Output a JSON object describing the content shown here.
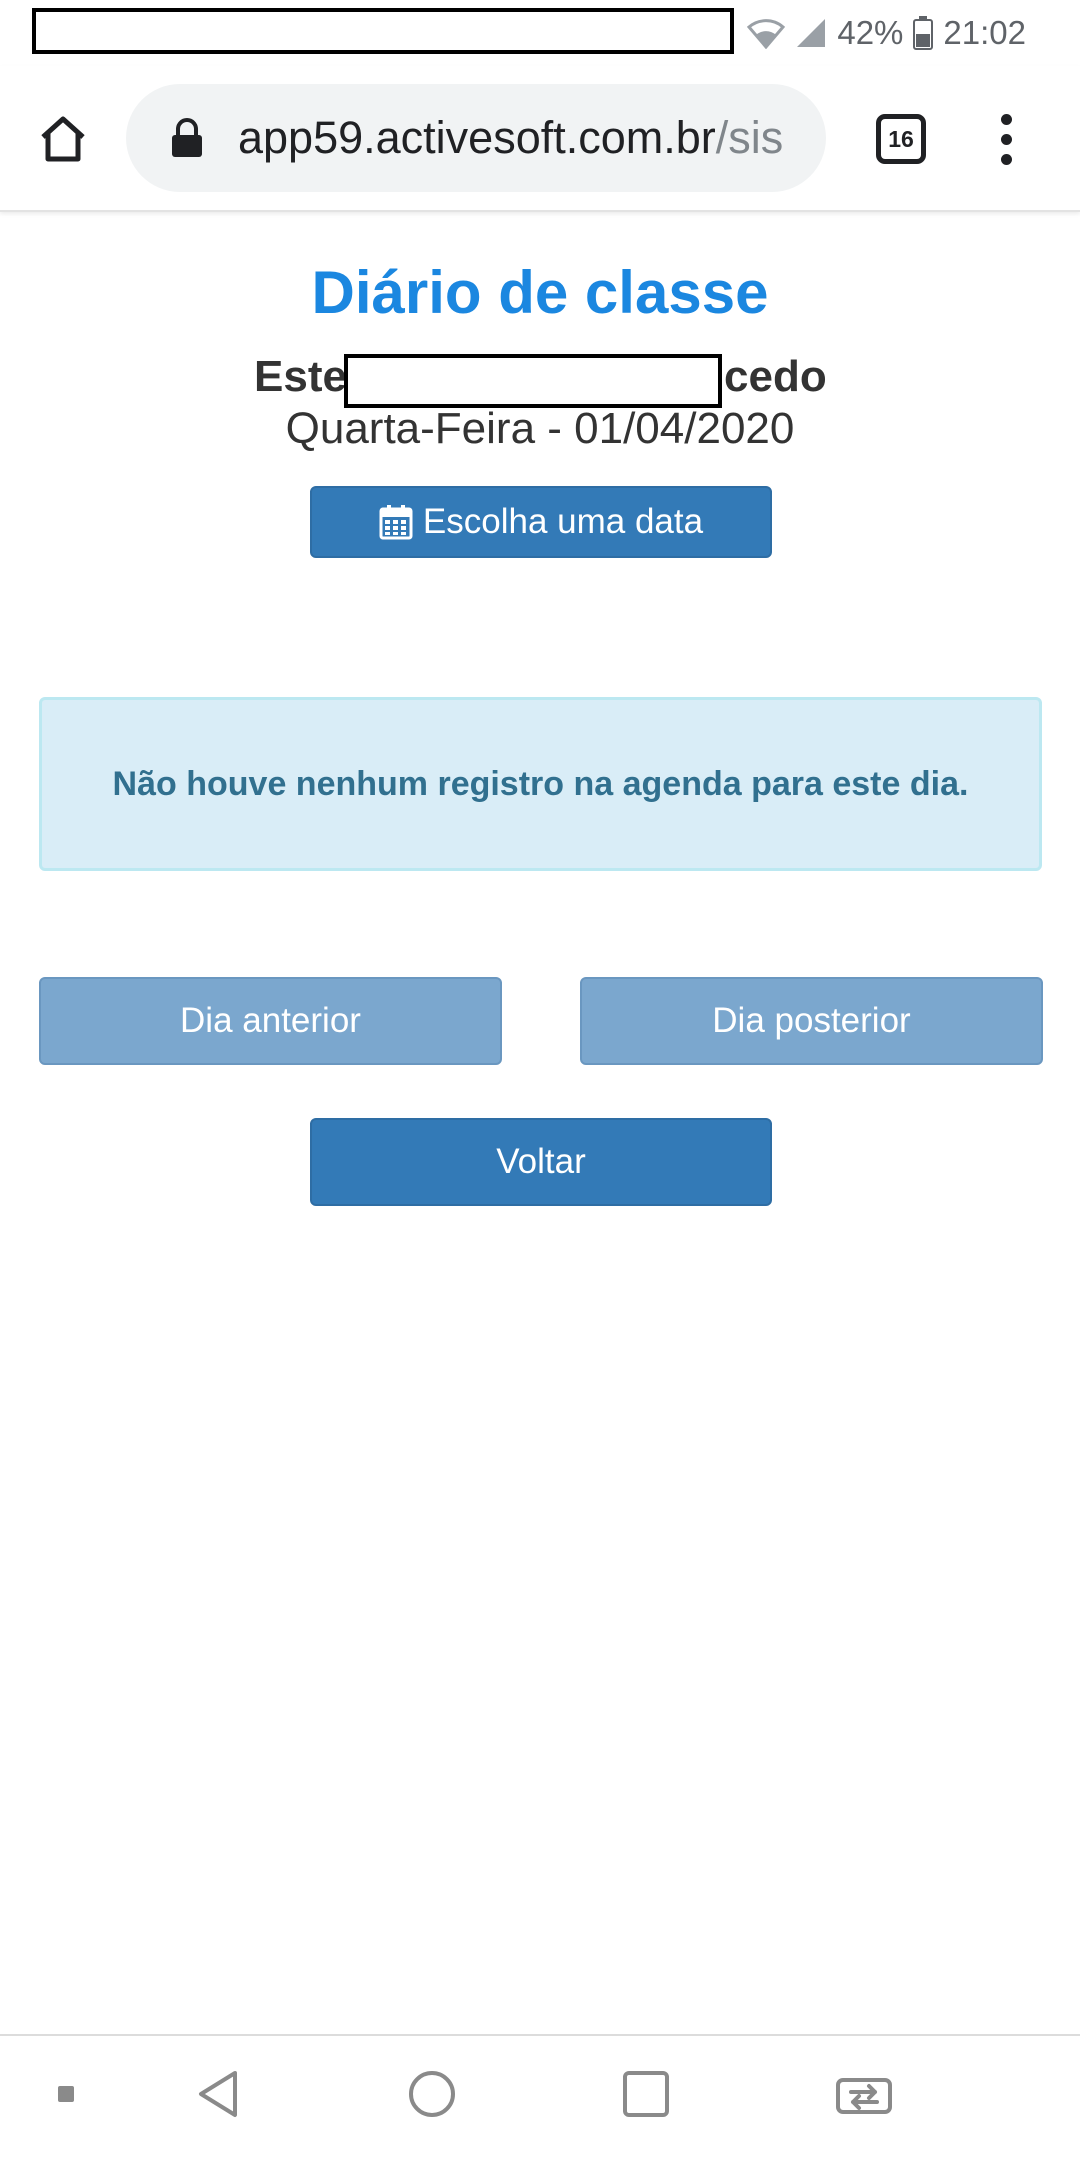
{
  "status_bar": {
    "battery_percent": "42%",
    "time": "21:02"
  },
  "browser": {
    "url_host": "app59.activesoft.com.br",
    "url_path": "/sis",
    "tab_count": "16"
  },
  "page": {
    "title": "Diário de classe",
    "student_prefix": "Este",
    "student_suffix": "cedo",
    "date_line": "Quarta-Feira - 01/04/2020",
    "choose_date_label": "Escolha uma data",
    "empty_message": "Não houve nenhum registro na agenda para este dia.",
    "prev_day_label": "Dia anterior",
    "next_day_label": "Dia posterior",
    "back_label": "Voltar"
  },
  "colors": {
    "title": "#1b87e0",
    "primary_button": "#337ab7",
    "disabled_button": "#7ba7ce",
    "alert_bg": "#d9edf7",
    "alert_text": "#31708f"
  }
}
